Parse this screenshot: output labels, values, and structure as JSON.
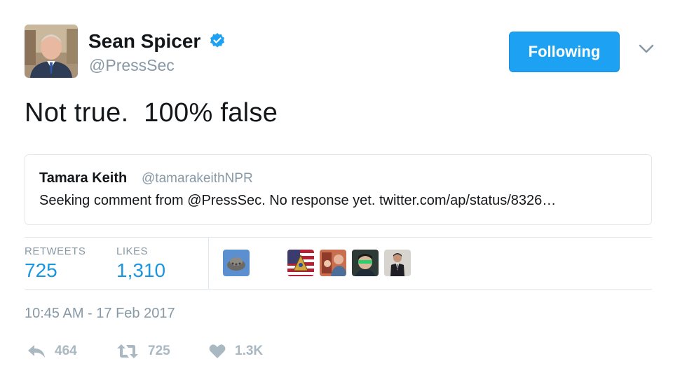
{
  "tweet": {
    "author": {
      "name": "Sean Spicer",
      "handle": "@PressSec",
      "verified": true
    },
    "follow_label": "Following",
    "text": "Not true.  100% false",
    "quoted": {
      "name": "Tamara Keith",
      "handle": "@tamarakeithNPR",
      "text": "Seeking comment from @PressSec. No response yet. twitter.com/ap/status/8326…"
    },
    "stats": {
      "retweets_label": "RETWEETS",
      "retweets": "725",
      "likes_label": "LIKES",
      "likes": "1,310"
    },
    "timestamp": "10:45 AM - 17 Feb 2017",
    "actions": {
      "replies": "464",
      "retweets": "725",
      "likes": "1.3K"
    }
  },
  "colors": {
    "accent": "#1da1f2",
    "link": "#1b95e0",
    "muted": "#8899a6",
    "action": "#aab8c2",
    "border": "#e1e8ed"
  },
  "icons": [
    "verified-badge-icon",
    "chevron-down-icon",
    "reply-icon",
    "retweet-icon",
    "heart-icon"
  ]
}
